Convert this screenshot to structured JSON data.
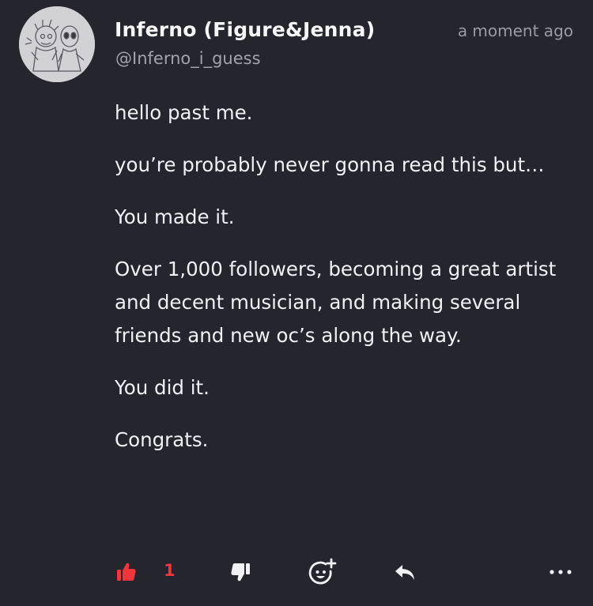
{
  "post": {
    "display_name": "Inferno (Figure&Jenna)",
    "handle": "@Inferno_i_guess",
    "timestamp": "a moment ago",
    "paragraphs": [
      "hello past me.",
      "you’re probably never gonna read this but…",
      "You made it.",
      "Over 1,000 followers, becoming a great artist and decent musician, and making several friends and new oc’s along the way.",
      "You did it.",
      "Congrats."
    ]
  },
  "actions": {
    "like_count": "1",
    "like_color": "#f0363b",
    "icons": [
      "thumbs-up-icon",
      "thumbs-down-icon",
      "add-reaction-icon",
      "reply-icon",
      "more-icon"
    ]
  },
  "colors": {
    "background": "#25252d",
    "text": "#f1f1f4",
    "muted": "#9b9ba6",
    "accent": "#f0363b"
  }
}
